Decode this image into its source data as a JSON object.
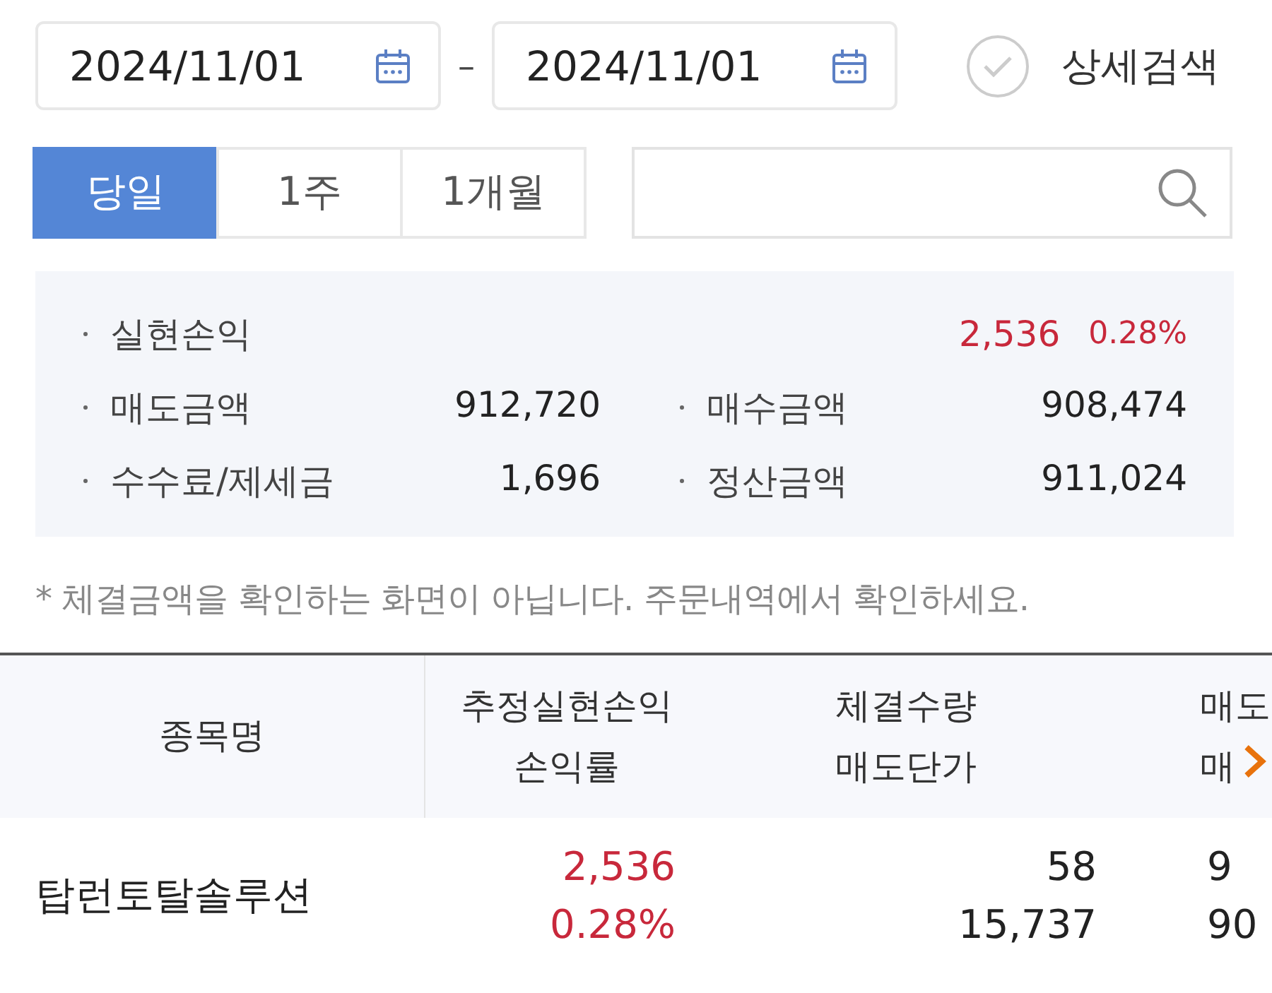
{
  "date_range": {
    "start": "2024/11/01",
    "separator": "–",
    "end": "2024/11/01"
  },
  "detail_search": {
    "label": "상세검색",
    "checked": false
  },
  "period_tabs": [
    {
      "label": "당일",
      "selected": true
    },
    {
      "label": "1주",
      "selected": false
    },
    {
      "label": "1개월",
      "selected": false
    }
  ],
  "summary": {
    "realized": {
      "label": "실현손익",
      "amount": "2,536",
      "rate": "0.28%"
    },
    "items": [
      {
        "label": "매도금액",
        "value": "912,720"
      },
      {
        "label": "매수금액",
        "value": "908,474"
      },
      {
        "label": "수수료/제세금",
        "value": "1,696"
      },
      {
        "label": "정산금액",
        "value": "911,024"
      }
    ]
  },
  "notice": "* 체결금액을 확인하는 화면이 아닙니다. 주문내역에서 확인하세요.",
  "table": {
    "columns": [
      {
        "lines": [
          "종목명"
        ]
      },
      {
        "lines": [
          "추정실현손익",
          "손익률"
        ]
      },
      {
        "lines": [
          "체결수량",
          "매도단가"
        ]
      },
      {
        "lines": [
          "매도",
          "매"
        ]
      }
    ],
    "rows": [
      {
        "name": "탑런토탈솔루션",
        "profit": "2,536",
        "rate": "0.28%",
        "quantity": "58",
        "price": "15,737",
        "column_4": [
          "9",
          "90"
        ]
      }
    ]
  }
}
